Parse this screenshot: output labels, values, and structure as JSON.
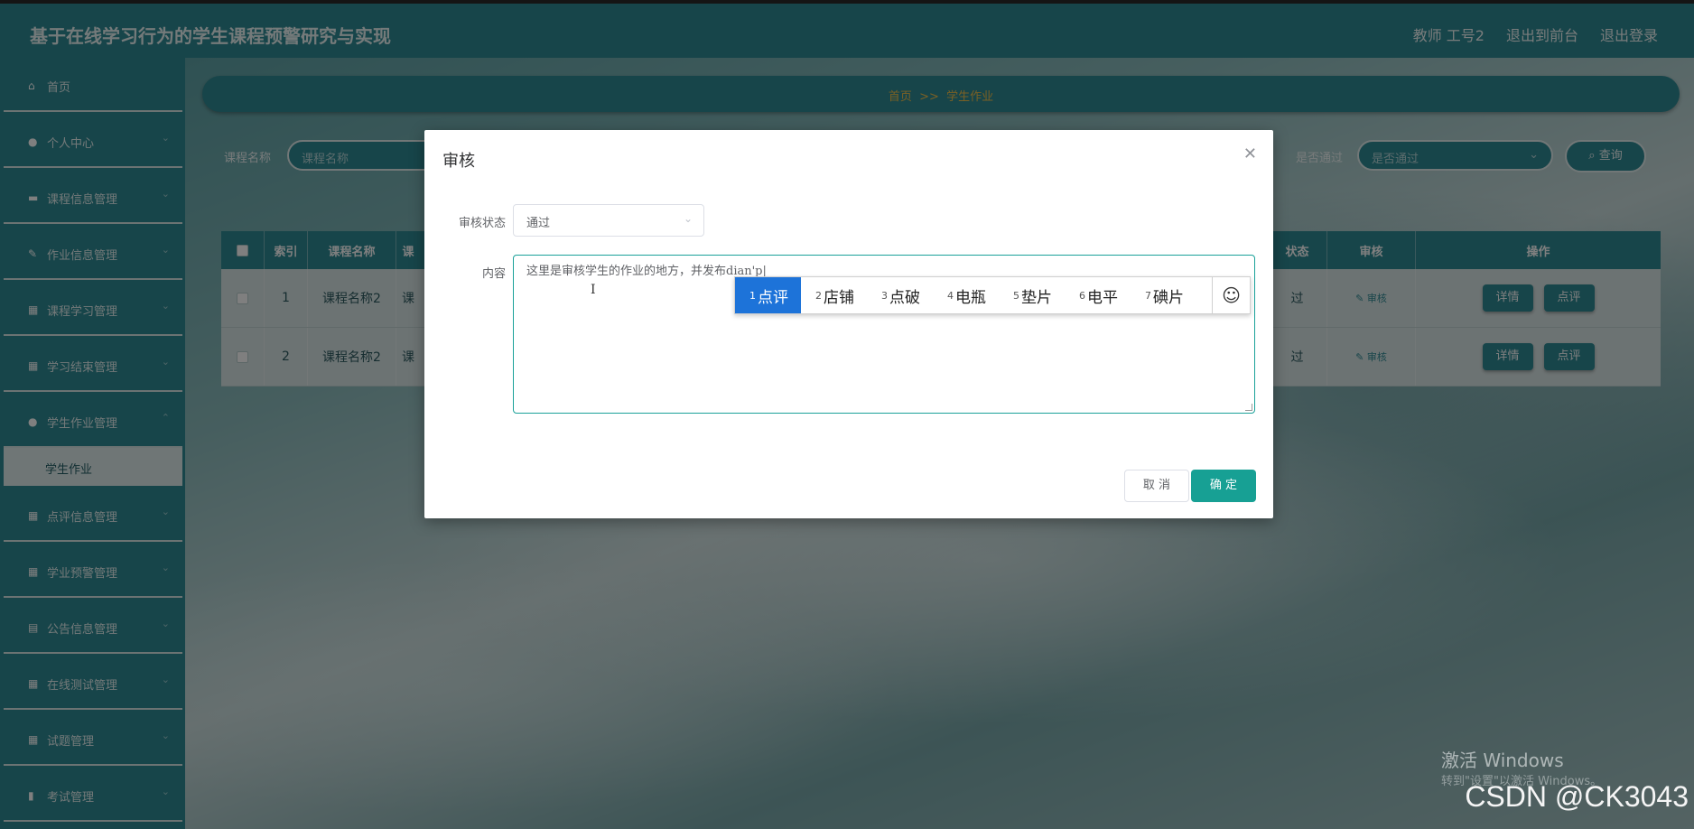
{
  "app": {
    "title": "基于在线学习行为的学生课程预警研究与实现"
  },
  "header_links": {
    "user": "教师 工号2",
    "front": "退出到前台",
    "logout": "退出登录"
  },
  "sidebar": {
    "items": [
      {
        "label": "首页",
        "icon": "home-icon"
      },
      {
        "label": "个人中心",
        "icon": "user-icon"
      },
      {
        "label": "课程信息管理",
        "icon": "book-icon"
      },
      {
        "label": "作业信息管理",
        "icon": "edit-icon"
      },
      {
        "label": "课程学习管理",
        "icon": "grid-icon"
      },
      {
        "label": "学习结束管理",
        "icon": "grid-icon"
      },
      {
        "label": "学生作业管理",
        "icon": "user-icon"
      },
      {
        "label": "点评信息管理",
        "icon": "grid-icon"
      },
      {
        "label": "学业预警管理",
        "icon": "grid-icon"
      },
      {
        "label": "公告信息管理",
        "icon": "clipboard-icon"
      },
      {
        "label": "在线测试管理",
        "icon": "grid-icon"
      },
      {
        "label": "试题管理",
        "icon": "grid-icon"
      },
      {
        "label": "考试管理",
        "icon": "bar-chart-icon"
      }
    ],
    "active_sub": "学生作业"
  },
  "breadcrumb": {
    "home": "首页",
    "sep": ">>",
    "current": "学生作业"
  },
  "filters": {
    "course_label": "课程名称",
    "course_placeholder": "课程名称",
    "pass_label": "是否通过",
    "pass_placeholder": "是否通过",
    "query": "查询"
  },
  "table": {
    "headers": {
      "index": "索引",
      "course": "课程名称",
      "col3": "课",
      "status": "状态",
      "audit": "审核",
      "ops": "操作"
    },
    "rows": [
      {
        "index": "1",
        "course": "课程名称2",
        "col3": "课",
        "status": "过",
        "audit": "审核",
        "detail": "详情",
        "review": "点评"
      },
      {
        "index": "2",
        "course": "课程名称2",
        "col3": "课",
        "status": "过",
        "audit": "审核",
        "detail": "详情",
        "review": "点评"
      }
    ]
  },
  "modal": {
    "title": "审核",
    "status_label": "审核状态",
    "status_value": "通过",
    "content_label": "内容",
    "content_value": "这里是审核学生的作业的地方，并发布dian'p",
    "cancel": "取 消",
    "confirm": "确 定"
  },
  "ime": {
    "candidates": [
      {
        "n": "1",
        "text": "点评"
      },
      {
        "n": "2",
        "text": "店铺"
      },
      {
        "n": "3",
        "text": "点破"
      },
      {
        "n": "4",
        "text": "电瓶"
      },
      {
        "n": "5",
        "text": "垫片"
      },
      {
        "n": "6",
        "text": "电平"
      },
      {
        "n": "7",
        "text": "碘片"
      }
    ]
  },
  "watermark": {
    "line1": "激活 Windows",
    "line2": "转到\"设置\"以激活 Windows。"
  },
  "csdn": "CSDN @CK3043",
  "colors": {
    "primary": "#2f8a94",
    "accent": "#17a094",
    "breadcrumb": "#f3c04a",
    "ime_active": "#1d73d9"
  }
}
